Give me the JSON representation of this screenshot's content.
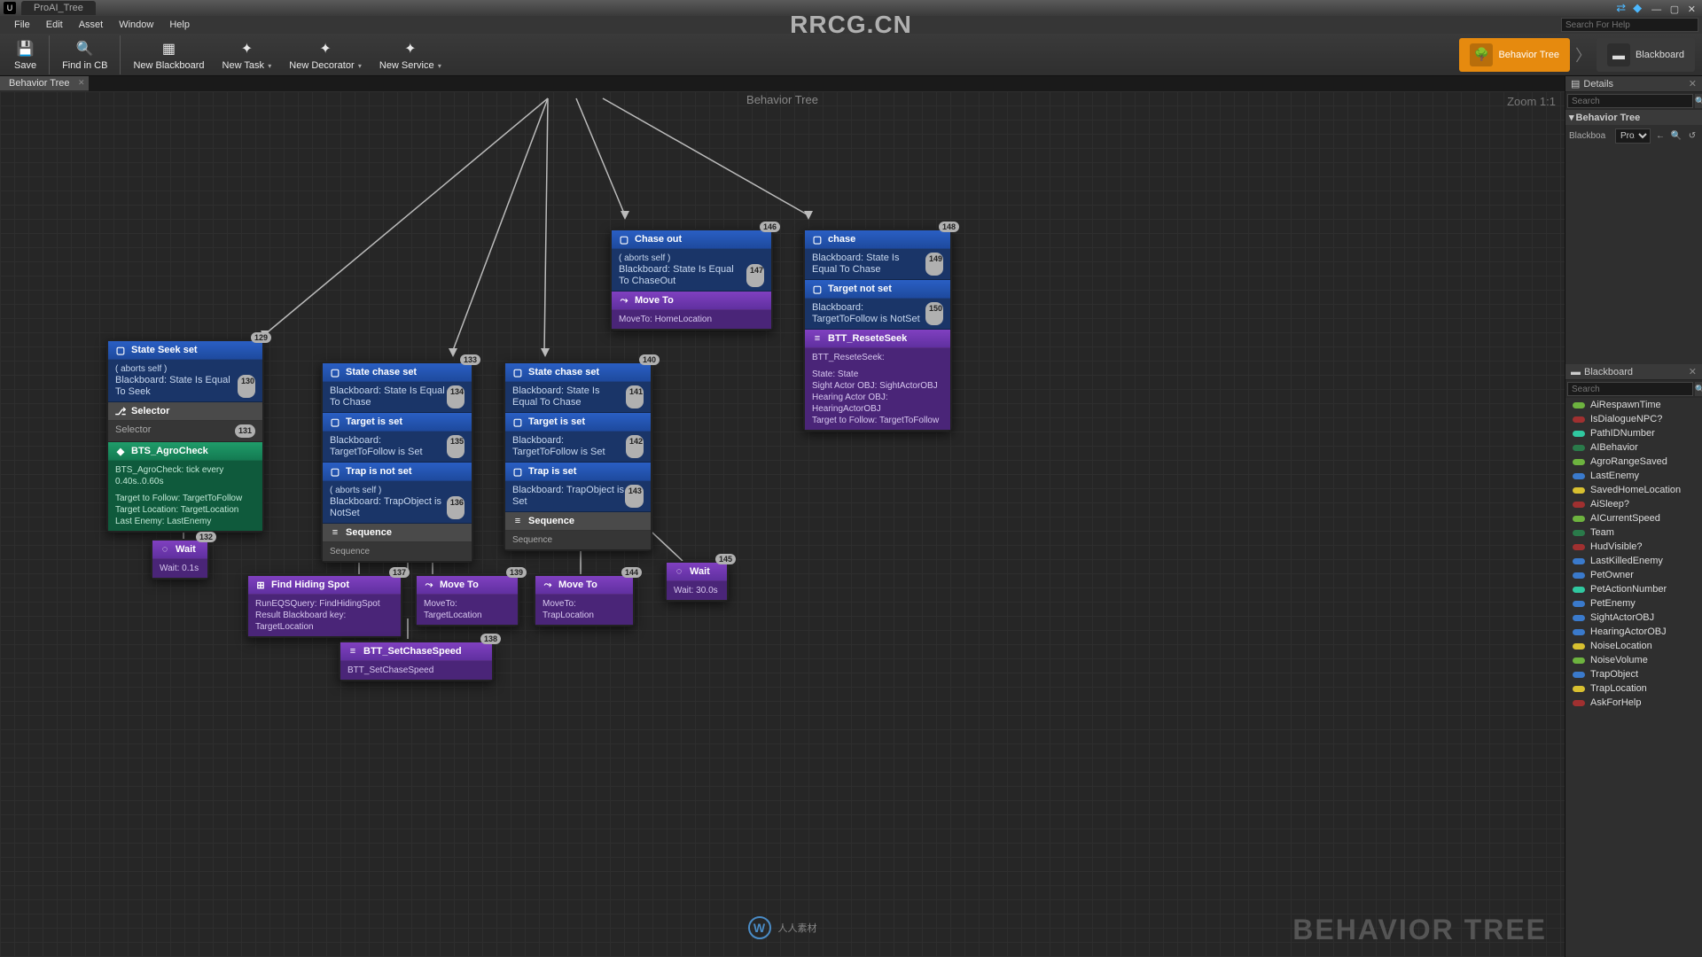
{
  "titlebar": {
    "tab_name": "ProAI_Tree"
  },
  "menubar": {
    "items": [
      "File",
      "Edit",
      "Asset",
      "Window",
      "Help"
    ],
    "search_placeholder": "Search For Help"
  },
  "watermark_top": "RRCG.CN",
  "toolbar": {
    "save": "Save",
    "find": "Find in CB",
    "new_bb": "New Blackboard",
    "new_task": "New Task",
    "new_dec": "New Decorator",
    "new_svc": "New Service"
  },
  "modes": {
    "bt": "Behavior Tree",
    "bb": "Blackboard"
  },
  "graph_tab": "Behavior Tree",
  "graph_title": "Behavior Tree",
  "zoom": "Zoom 1:1",
  "bt_watermark": "BEHAVIOR TREE",
  "logo_text": "人人素材",
  "details": {
    "title": "Details",
    "search_placeholder": "Search",
    "cat": "Behavior Tree",
    "bb_label": "Blackboa",
    "bb_value": "ProAI"
  },
  "blackboard": {
    "title": "Blackboard",
    "search_placeholder": "Search",
    "keys": [
      {
        "n": "AiRespawnTime",
        "c": "#6db33f"
      },
      {
        "n": "IsDialogueNPC?",
        "c": "#a03030"
      },
      {
        "n": "PathIDNumber",
        "c": "#30c8a0"
      },
      {
        "n": "AIBehavior",
        "c": "#2a7a4a"
      },
      {
        "n": "AgroRangeSaved",
        "c": "#6db33f"
      },
      {
        "n": "LastEnemy",
        "c": "#3a7acc"
      },
      {
        "n": "SavedHomeLocation",
        "c": "#d8c030"
      },
      {
        "n": "AiSleep?",
        "c": "#a03030"
      },
      {
        "n": "AICurrentSpeed",
        "c": "#6db33f"
      },
      {
        "n": "Team",
        "c": "#2a7a4a"
      },
      {
        "n": "HudVisible?",
        "c": "#a03030"
      },
      {
        "n": "LastKilledEnemy",
        "c": "#3a7acc"
      },
      {
        "n": "PetOwner",
        "c": "#3a7acc"
      },
      {
        "n": "PetActionNumber",
        "c": "#30c8a0"
      },
      {
        "n": "PetEnemy",
        "c": "#3a7acc"
      },
      {
        "n": "SightActorOBJ",
        "c": "#3a7acc"
      },
      {
        "n": "HearingActorOBJ",
        "c": "#3a7acc"
      },
      {
        "n": "NoiseLocation",
        "c": "#d8c030"
      },
      {
        "n": "NoiseVolume",
        "c": "#6db33f"
      },
      {
        "n": "TrapObject",
        "c": "#3a7acc"
      },
      {
        "n": "TrapLocation",
        "c": "#d8c030"
      },
      {
        "n": "AskForHelp",
        "c": "#a03030"
      }
    ]
  },
  "nodes": {
    "n129": {
      "idx": "129",
      "seek_title": "State Seek set",
      "seek_sub1": "( aborts self )",
      "seek_sub2": "Blackboard: State Is Equal To Seek",
      "seek_idx": "130",
      "sel_title": "Selector",
      "sel_sub": "Selector",
      "sel_idx": "131",
      "agro_title": "BTS_AgroCheck",
      "agro_sub1": "BTS_AgroCheck: tick every 0.40s..0.60s",
      "agro_sub2": "Target to Follow: TargetToFollow",
      "agro_sub3": "Target Location: TargetLocation",
      "agro_sub4": "Last Enemy: LastEnemy"
    },
    "n132": {
      "idx": "132",
      "title": "Wait",
      "sub": "Wait: 0.1s"
    },
    "n133": {
      "idx": "133",
      "d1_title": "State chase set",
      "d1_sub": "Blackboard: State Is Equal To Chase",
      "d1_idx": "134",
      "d2_title": "Target is set",
      "d2_sub": "Blackboard: TargetToFollow is Set",
      "d2_idx": "135",
      "d3_title": "Trap is not set",
      "d3_sub1": "( aborts self )",
      "d3_sub2": "Blackboard: TrapObject is NotSet",
      "d3_idx": "136",
      "seq_title": "Sequence",
      "seq_sub": "Sequence"
    },
    "n137": {
      "idx": "137",
      "title": "Find Hiding Spot",
      "sub1": "RunEQSQuery: FindHidingSpot",
      "sub2": "Result Blackboard key: TargetLocation"
    },
    "n138": {
      "idx": "138",
      "title": "BTT_SetChaseSpeed",
      "sub": "BTT_SetChaseSpeed"
    },
    "n139": {
      "idx": "139",
      "title": "Move To",
      "sub": "MoveTo: TargetLocation"
    },
    "n140": {
      "idx": "140",
      "d1_title": "State chase set",
      "d1_sub": "Blackboard: State Is Equal To Chase",
      "d1_idx": "141",
      "d2_title": "Target is set",
      "d2_sub": "Blackboard: TargetToFollow is Set",
      "d2_idx": "142",
      "d3_title": "Trap is set",
      "d3_sub": "Blackboard: TrapObject is Set",
      "d3_idx": "143",
      "seq_title": "Sequence",
      "seq_sub": "Sequence"
    },
    "n144": {
      "idx": "144",
      "title": "Move To",
      "sub": "MoveTo: TrapLocation"
    },
    "n145": {
      "idx": "145",
      "title": "Wait",
      "sub": "Wait: 30.0s"
    },
    "n146": {
      "idx": "146",
      "d1_title": "Chase out",
      "d1_sub1": "( aborts self )",
      "d1_sub2": "Blackboard: State Is Equal To ChaseOut",
      "d1_idx": "147",
      "t_title": "Move To",
      "t_sub": "MoveTo: HomeLocation"
    },
    "n148": {
      "idx": "148",
      "d1_title": "chase",
      "d1_sub": "Blackboard: State Is Equal To Chase",
      "d1_idx": "149",
      "d2_title": "Target not set",
      "d2_sub": "Blackboard: TargetToFollow is NotSet",
      "d2_idx": "150",
      "t_title": "BTT_ReseteSeek",
      "t_sub1": "BTT_ReseteSeek:",
      "t_sub2": "State: State",
      "t_sub3": "Sight Actor OBJ: SightActorOBJ",
      "t_sub4": "Hearing Actor OBJ: HearingActorOBJ",
      "t_sub5": "Target to Follow: TargetToFollow"
    }
  }
}
